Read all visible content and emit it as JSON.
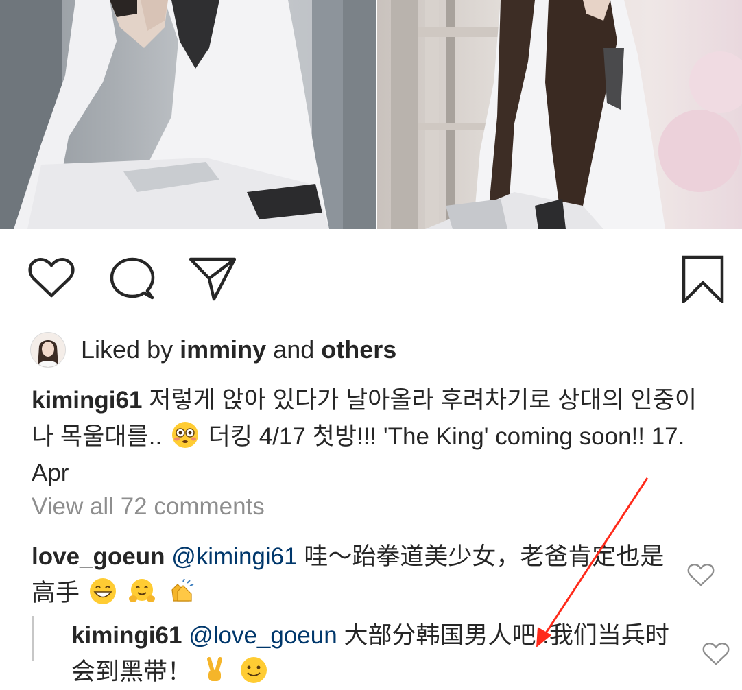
{
  "post": {
    "liked_by": {
      "prefix": "Liked by",
      "user": "imminy",
      "joiner": "and",
      "others": "others"
    },
    "caption": {
      "username": "kimingi61",
      "text_1": "저렇게 앉아 있다가 날아올라 후려차기로 상대의 인중이나 목울대를..",
      "text_2": "더킹 4/17 첫방!!! 'The King' coming soon!! 17. Apr"
    },
    "view_all_comments": "View all 72 comments"
  },
  "comments": [
    {
      "username": "love_goeun",
      "mention": "@kimingi61",
      "text": "哇～跆拳道美少女，老爸肯定也是高手"
    }
  ],
  "replies": [
    {
      "username": "kimingi61",
      "mention": "@love_goeun",
      "text": "大部分韩国男人吧..我们当兵时会到黑带！"
    }
  ],
  "icons": {
    "like": "heart-icon",
    "comment": "comment-bubble-icon",
    "share": "paper-plane-icon",
    "save": "bookmark-icon",
    "comment_like": "heart-outline-icon",
    "emoji_flushed": "flushed-face-emoji",
    "emoji_grin": "grinning-face-emoji",
    "emoji_hug": "hugging-face-emoji",
    "emoji_clap": "clapping-hands-emoji",
    "emoji_victory": "victory-hand-emoji",
    "emoji_smile": "smiling-face-emoji"
  },
  "colors": {
    "text": "#262626",
    "secondary": "#8e8e8e",
    "mention": "#00376b",
    "annotation_arrow": "#ff2a1a"
  }
}
